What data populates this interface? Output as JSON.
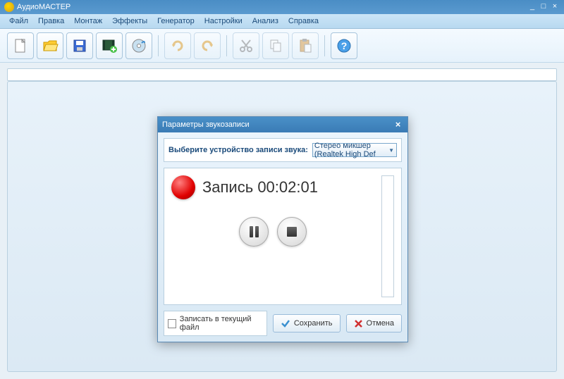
{
  "app": {
    "title": "АудиоМАСТЕР"
  },
  "menu": {
    "file": "Файл",
    "edit": "Правка",
    "montage": "Монтаж",
    "effects": "Эффекты",
    "generator": "Генератор",
    "settings": "Настройки",
    "analysis": "Анализ",
    "help": "Справка"
  },
  "dialog": {
    "title": "Параметры звукозаписи",
    "device_label": "Выберите устройство записи звука:",
    "device_value": "Стерео микшер (Realtek High Def",
    "status_prefix": "Запись",
    "time": "00:02:01",
    "record_to_current": "Записать в текущий файл",
    "save": "Сохранить",
    "cancel": "Отмена"
  }
}
